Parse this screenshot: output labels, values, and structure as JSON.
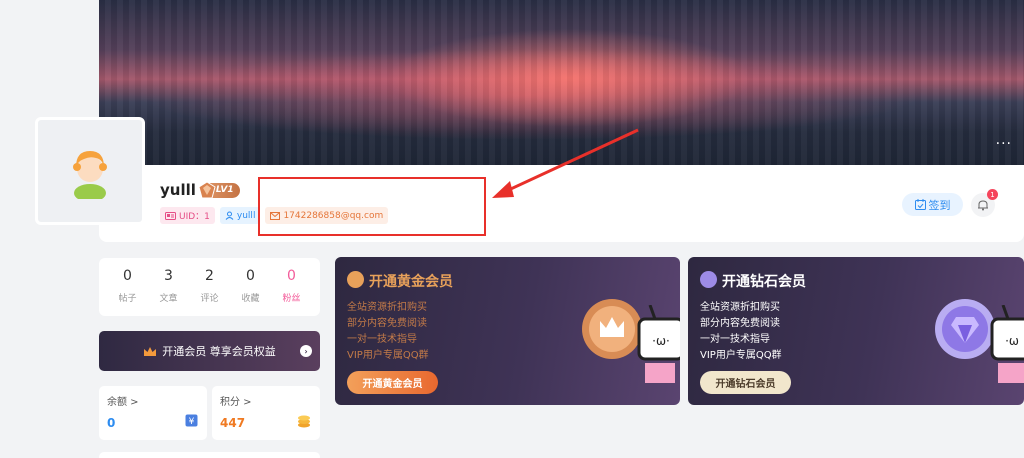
{
  "profile": {
    "username": "yulll",
    "level": "LV1",
    "uid_tag": "UID：1",
    "user_tag": "yulll",
    "email_tag": "1742286858@qq.com",
    "more": "···",
    "signin_label": "签到",
    "notification_count": "1"
  },
  "stats": [
    {
      "value": "0",
      "label": "帖子"
    },
    {
      "value": "3",
      "label": "文章"
    },
    {
      "value": "2",
      "label": "评论"
    },
    {
      "value": "0",
      "label": "收藏"
    },
    {
      "value": "0",
      "label": "粉丝"
    }
  ],
  "vip_bar": {
    "label": "开通会员 尊享会员权益"
  },
  "wallet": {
    "balance_label": "余额 >",
    "balance_value": "0",
    "points_label": "积分 >",
    "points_value": "447"
  },
  "vip_cards": {
    "gold": {
      "title": "开通黄金会员",
      "perks": [
        "全站资源折扣购买",
        "部分内容免费阅读",
        "一对一技术指导",
        "VIP用户专属QQ群"
      ],
      "button": "开通黄金会员"
    },
    "diamond": {
      "title": "开通钻石会员",
      "perks": [
        "全站资源折扣购买",
        "部分内容免费阅读",
        "一对一技术指导",
        "VIP用户专属QQ群"
      ],
      "button": "开通钻石会员"
    }
  },
  "colors": {
    "highlight": "#e8302a",
    "accent_blue": "#2d8cf0",
    "pink": "#f35c9a",
    "gold": "#e8a15a"
  }
}
